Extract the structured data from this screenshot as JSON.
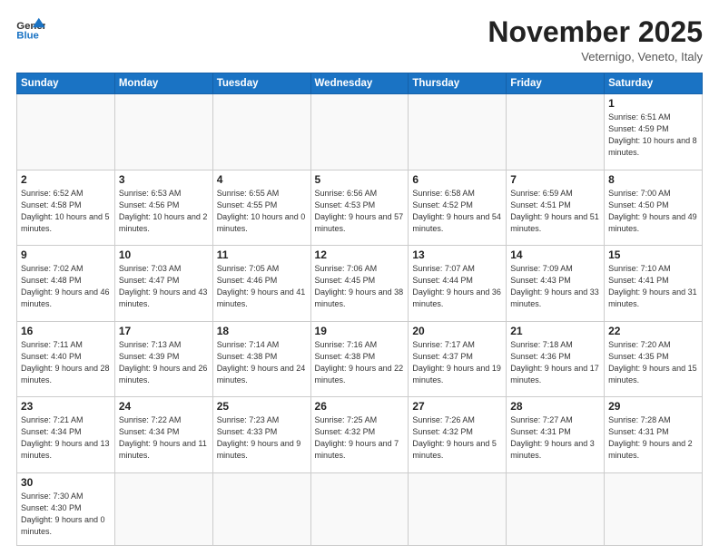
{
  "logo": {
    "text_general": "General",
    "text_blue": "Blue"
  },
  "header": {
    "month": "November 2025",
    "location": "Veternigo, Veneto, Italy"
  },
  "days_of_week": [
    "Sunday",
    "Monday",
    "Tuesday",
    "Wednesday",
    "Thursday",
    "Friday",
    "Saturday"
  ],
  "weeks": [
    [
      {
        "day": "",
        "info": ""
      },
      {
        "day": "",
        "info": ""
      },
      {
        "day": "",
        "info": ""
      },
      {
        "day": "",
        "info": ""
      },
      {
        "day": "",
        "info": ""
      },
      {
        "day": "",
        "info": ""
      },
      {
        "day": "1",
        "info": "Sunrise: 6:51 AM\nSunset: 4:59 PM\nDaylight: 10 hours\nand 8 minutes."
      }
    ],
    [
      {
        "day": "2",
        "info": "Sunrise: 6:52 AM\nSunset: 4:58 PM\nDaylight: 10 hours\nand 5 minutes."
      },
      {
        "day": "3",
        "info": "Sunrise: 6:53 AM\nSunset: 4:56 PM\nDaylight: 10 hours\nand 2 minutes."
      },
      {
        "day": "4",
        "info": "Sunrise: 6:55 AM\nSunset: 4:55 PM\nDaylight: 10 hours\nand 0 minutes."
      },
      {
        "day": "5",
        "info": "Sunrise: 6:56 AM\nSunset: 4:53 PM\nDaylight: 9 hours\nand 57 minutes."
      },
      {
        "day": "6",
        "info": "Sunrise: 6:58 AM\nSunset: 4:52 PM\nDaylight: 9 hours\nand 54 minutes."
      },
      {
        "day": "7",
        "info": "Sunrise: 6:59 AM\nSunset: 4:51 PM\nDaylight: 9 hours\nand 51 minutes."
      },
      {
        "day": "8",
        "info": "Sunrise: 7:00 AM\nSunset: 4:50 PM\nDaylight: 9 hours\nand 49 minutes."
      }
    ],
    [
      {
        "day": "9",
        "info": "Sunrise: 7:02 AM\nSunset: 4:48 PM\nDaylight: 9 hours\nand 46 minutes."
      },
      {
        "day": "10",
        "info": "Sunrise: 7:03 AM\nSunset: 4:47 PM\nDaylight: 9 hours\nand 43 minutes."
      },
      {
        "day": "11",
        "info": "Sunrise: 7:05 AM\nSunset: 4:46 PM\nDaylight: 9 hours\nand 41 minutes."
      },
      {
        "day": "12",
        "info": "Sunrise: 7:06 AM\nSunset: 4:45 PM\nDaylight: 9 hours\nand 38 minutes."
      },
      {
        "day": "13",
        "info": "Sunrise: 7:07 AM\nSunset: 4:44 PM\nDaylight: 9 hours\nand 36 minutes."
      },
      {
        "day": "14",
        "info": "Sunrise: 7:09 AM\nSunset: 4:43 PM\nDaylight: 9 hours\nand 33 minutes."
      },
      {
        "day": "15",
        "info": "Sunrise: 7:10 AM\nSunset: 4:41 PM\nDaylight: 9 hours\nand 31 minutes."
      }
    ],
    [
      {
        "day": "16",
        "info": "Sunrise: 7:11 AM\nSunset: 4:40 PM\nDaylight: 9 hours\nand 28 minutes."
      },
      {
        "day": "17",
        "info": "Sunrise: 7:13 AM\nSunset: 4:39 PM\nDaylight: 9 hours\nand 26 minutes."
      },
      {
        "day": "18",
        "info": "Sunrise: 7:14 AM\nSunset: 4:38 PM\nDaylight: 9 hours\nand 24 minutes."
      },
      {
        "day": "19",
        "info": "Sunrise: 7:16 AM\nSunset: 4:38 PM\nDaylight: 9 hours\nand 22 minutes."
      },
      {
        "day": "20",
        "info": "Sunrise: 7:17 AM\nSunset: 4:37 PM\nDaylight: 9 hours\nand 19 minutes."
      },
      {
        "day": "21",
        "info": "Sunrise: 7:18 AM\nSunset: 4:36 PM\nDaylight: 9 hours\nand 17 minutes."
      },
      {
        "day": "22",
        "info": "Sunrise: 7:20 AM\nSunset: 4:35 PM\nDaylight: 9 hours\nand 15 minutes."
      }
    ],
    [
      {
        "day": "23",
        "info": "Sunrise: 7:21 AM\nSunset: 4:34 PM\nDaylight: 9 hours\nand 13 minutes."
      },
      {
        "day": "24",
        "info": "Sunrise: 7:22 AM\nSunset: 4:34 PM\nDaylight: 9 hours\nand 11 minutes."
      },
      {
        "day": "25",
        "info": "Sunrise: 7:23 AM\nSunset: 4:33 PM\nDaylight: 9 hours\nand 9 minutes."
      },
      {
        "day": "26",
        "info": "Sunrise: 7:25 AM\nSunset: 4:32 PM\nDaylight: 9 hours\nand 7 minutes."
      },
      {
        "day": "27",
        "info": "Sunrise: 7:26 AM\nSunset: 4:32 PM\nDaylight: 9 hours\nand 5 minutes."
      },
      {
        "day": "28",
        "info": "Sunrise: 7:27 AM\nSunset: 4:31 PM\nDaylight: 9 hours\nand 3 minutes."
      },
      {
        "day": "29",
        "info": "Sunrise: 7:28 AM\nSunset: 4:31 PM\nDaylight: 9 hours\nand 2 minutes."
      }
    ],
    [
      {
        "day": "30",
        "info": "Sunrise: 7:30 AM\nSunset: 4:30 PM\nDaylight: 9 hours\nand 0 minutes."
      },
      {
        "day": "",
        "info": ""
      },
      {
        "day": "",
        "info": ""
      },
      {
        "day": "",
        "info": ""
      },
      {
        "day": "",
        "info": ""
      },
      {
        "day": "",
        "info": ""
      },
      {
        "day": "",
        "info": ""
      }
    ]
  ]
}
